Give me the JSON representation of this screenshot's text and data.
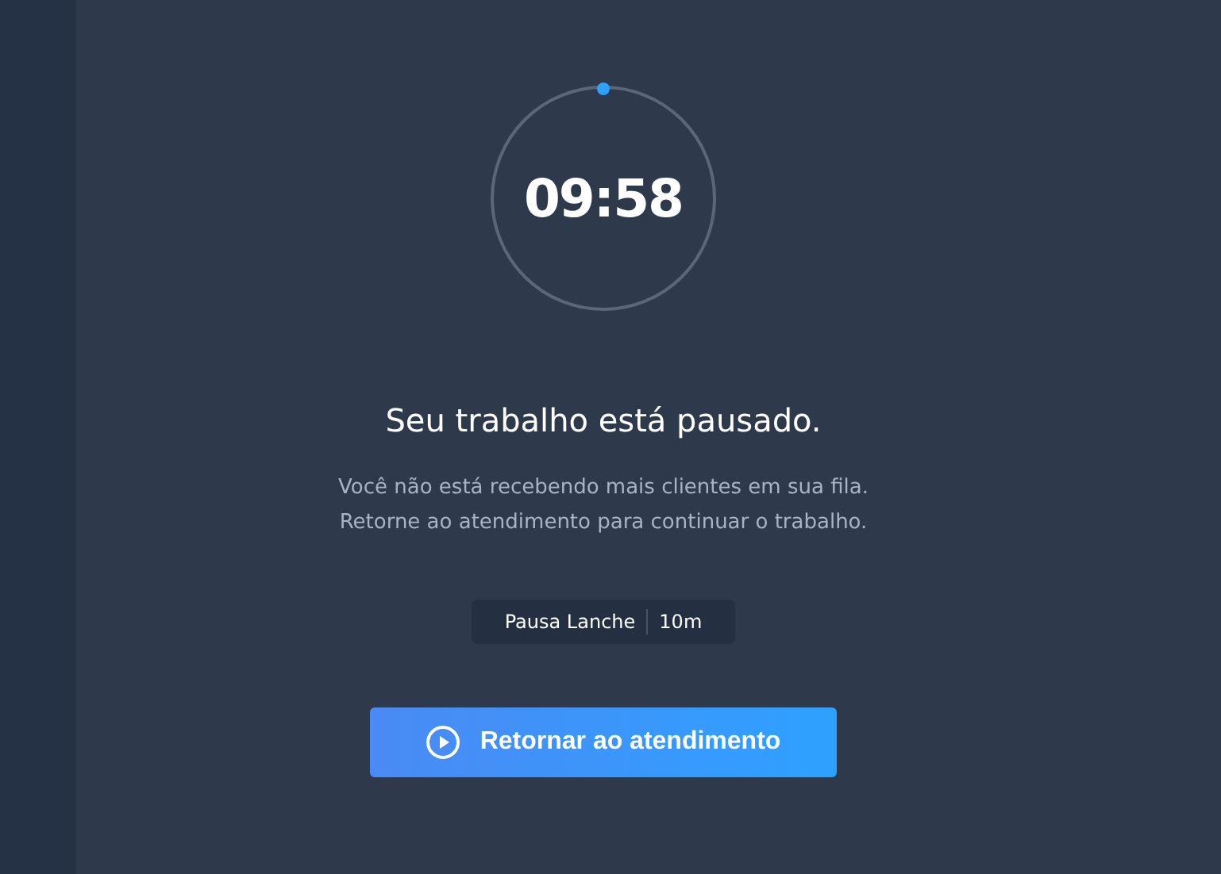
{
  "timer": {
    "time": "09:58"
  },
  "title": "Seu trabalho está pausado.",
  "message": "Você não está recebendo mais clientes em sua fila. Retorne ao atendimento para continuar o trabalho.",
  "pause": {
    "reason": "Pausa Lanche",
    "duration": "10m"
  },
  "resume_button": {
    "label": "Retornar ao atendimento"
  }
}
